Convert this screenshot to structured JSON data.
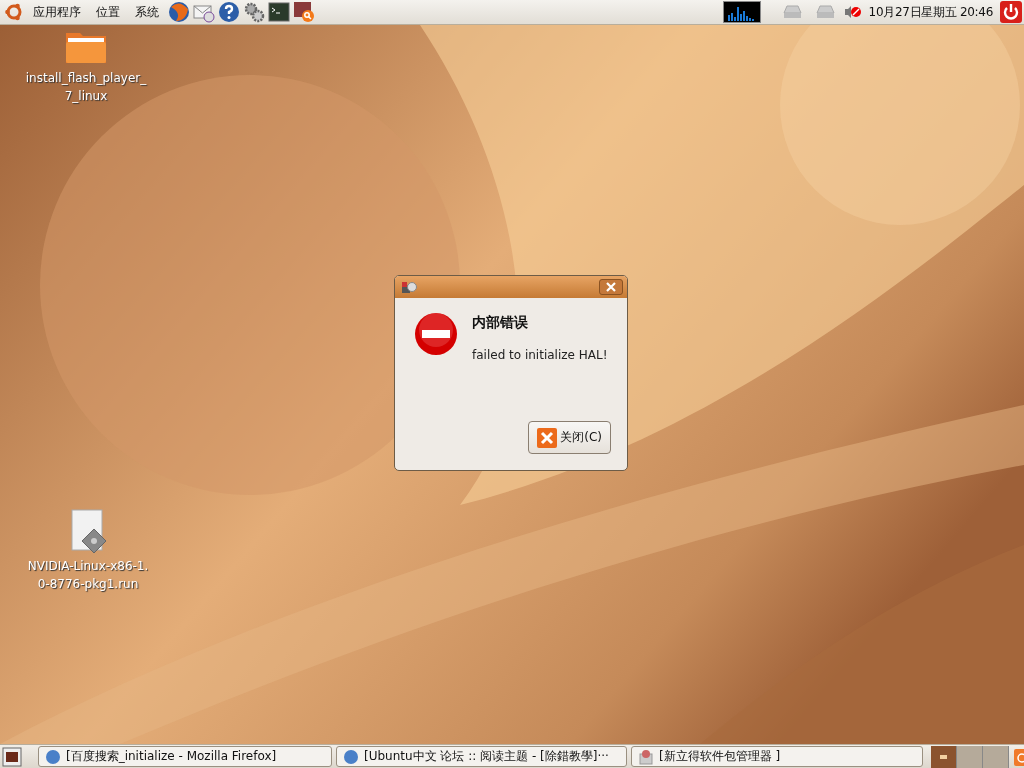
{
  "top_panel": {
    "menus": [
      "应用程序",
      "位置",
      "系统"
    ],
    "clock": "10月27日星期五 20:46"
  },
  "desktop_icons": [
    {
      "kind": "folder",
      "label_lines": [
        "install_flash_player_",
        "7_linux"
      ]
    },
    {
      "kind": "file",
      "label_lines": [
        "NVIDIA-Linux-x86-1.",
        "0-8776-pkg1.run"
      ]
    }
  ],
  "dialog": {
    "heading": "内部错误",
    "message": "failed to initialize HAL!",
    "button": "关闭(C)"
  },
  "taskbar": {
    "tasks": [
      {
        "kind": "browser",
        "label": "[百度搜索_initialize - Mozilla Firefox]",
        "selected": false
      },
      {
        "kind": "browser",
        "label": "[Ubuntu中文 论坛 :: 阅读主题 - [除錯教學]···",
        "selected": false
      },
      {
        "kind": "package",
        "label": "[新立得软件包管理器 ]",
        "selected": false
      }
    ],
    "workspaces": [
      {
        "selected": true
      },
      {
        "selected": false
      },
      {
        "selected": false
      }
    ]
  }
}
